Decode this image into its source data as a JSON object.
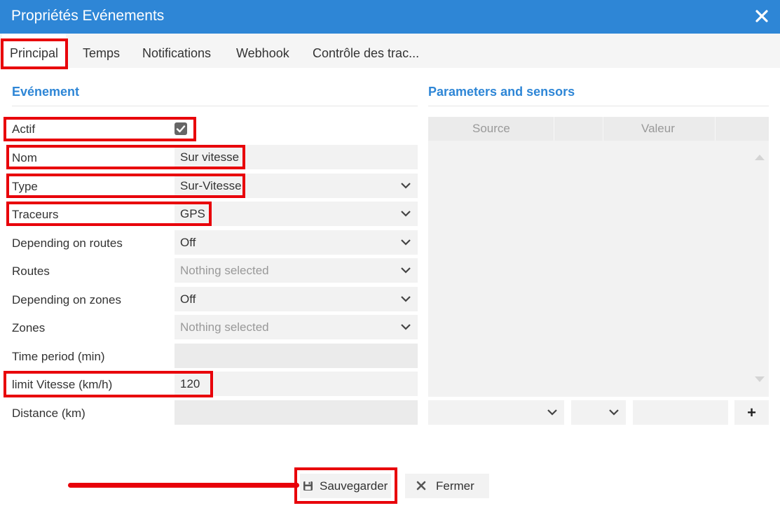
{
  "window": {
    "title": "Propriétés Evénements",
    "close_icon": "close-icon"
  },
  "tabs": [
    {
      "label": "Principal",
      "active": true
    },
    {
      "label": "Temps"
    },
    {
      "label": "Notifications"
    },
    {
      "label": "Webhook"
    },
    {
      "label": "Contrôle des trac..."
    }
  ],
  "event_section": {
    "title": "Evénement",
    "fields": {
      "actif": {
        "label": "Actif",
        "checked": true
      },
      "nom": {
        "label": "Nom",
        "value": "Sur vitesse"
      },
      "type": {
        "label": "Type",
        "value": "Sur-Vitesse"
      },
      "traceurs": {
        "label": "Traceurs",
        "value": "GPS"
      },
      "depending_routes": {
        "label": "Depending on routes",
        "value": "Off"
      },
      "routes": {
        "label": "Routes",
        "placeholder": "Nothing selected"
      },
      "depending_zones": {
        "label": "Depending on zones",
        "value": "Off"
      },
      "zones": {
        "label": "Zones",
        "placeholder": "Nothing selected"
      },
      "time_period": {
        "label": "Time period (min)",
        "value": ""
      },
      "limit_vitesse": {
        "label": "limit Vitesse (km/h)",
        "value": "120"
      },
      "distance": {
        "label": "Distance (km)",
        "value": ""
      }
    }
  },
  "sensors_section": {
    "title": "Parameters and sensors",
    "columns": [
      "Source",
      "Valeur"
    ],
    "add_label": "+"
  },
  "buttons": {
    "save": "Sauvegarder",
    "close": "Fermer"
  },
  "colors": {
    "titlebar": "#2e86d6",
    "accent": "#2e86d6",
    "highlight": "#e8000a",
    "field_bg": "#f2f2f2"
  }
}
